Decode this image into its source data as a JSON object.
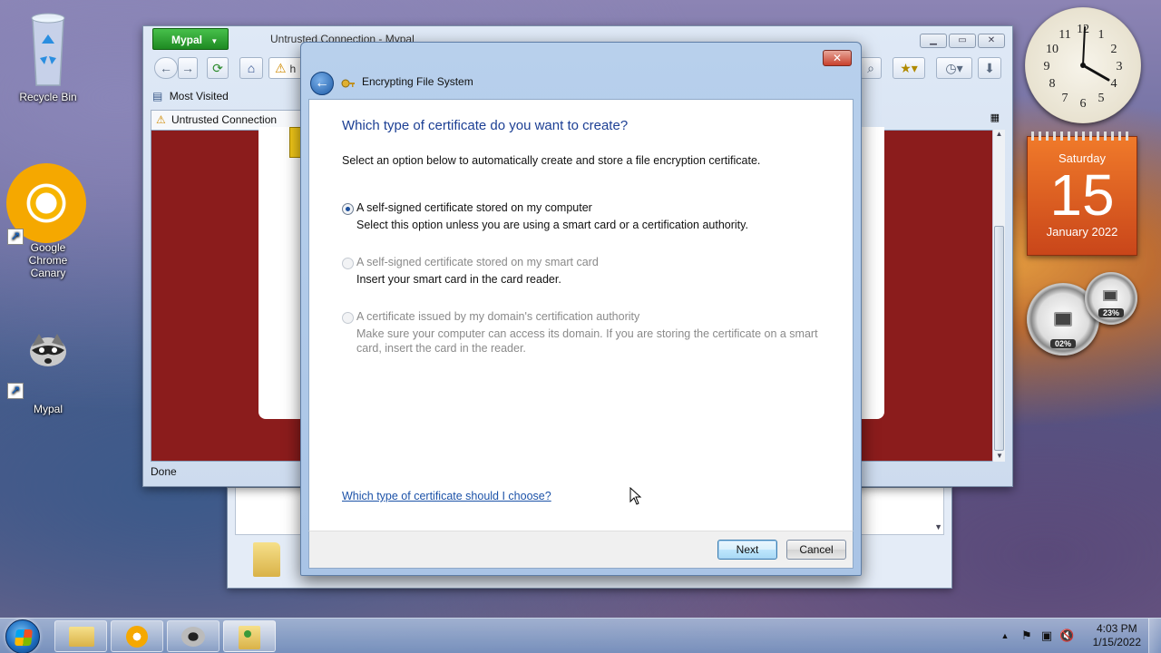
{
  "desktop": {
    "icons": [
      {
        "label": "Recycle Bin",
        "icon": "recycle-bin-icon"
      },
      {
        "label": "Google Chrome Canary",
        "icon": "chrome-canary-icon"
      },
      {
        "label": "Mypal",
        "icon": "mypal-icon"
      }
    ]
  },
  "gadgets": {
    "calendar": {
      "day": "Saturday",
      "date": "15",
      "month": "January 2022"
    },
    "meter": {
      "cpu": "02%",
      "memory": "23%"
    }
  },
  "browser": {
    "menu_button": "Mypal",
    "title": "Untrusted Connection - Mypal",
    "address_partial": "h",
    "bookmarks_item": "Most Visited",
    "tab_label": "Untrusted Connection",
    "status": "Done"
  },
  "dialog": {
    "title": "Encrypting File System",
    "heading": "Which type of certificate do you want to create?",
    "intro": "Select an option below to automatically create and store a file encryption certificate.",
    "options": [
      {
        "label": "A self-signed certificate stored on my computer",
        "description": "Select this option unless you are using a smart card or a certification authority.",
        "checked": true,
        "enabled": true
      },
      {
        "label": "A self-signed certificate stored on my smart card",
        "description": "Insert your smart card in the card reader.",
        "checked": false,
        "enabled": false
      },
      {
        "label": "A certificate issued by my domain's certification authority",
        "description": "Make sure your computer can access its domain. If you are storing the certificate on a smart card, insert the card in the reader.",
        "checked": false,
        "enabled": false
      }
    ],
    "help_link": "Which type of certificate should I choose?",
    "next_button": "Next",
    "cancel_button": "Cancel"
  },
  "taskbar": {
    "time": "4:03 PM",
    "date": "1/15/2022",
    "pinned": [
      "file-explorer-icon",
      "chrome-canary-icon",
      "mypal-icon",
      "certificate-manager-icon"
    ]
  },
  "colors": {
    "heading": "#1c3f94",
    "link": "#1c52a8",
    "calendar": "#e05a22",
    "browser_menu": "#2ea332",
    "untrusted_page": "#8b1c1c"
  }
}
